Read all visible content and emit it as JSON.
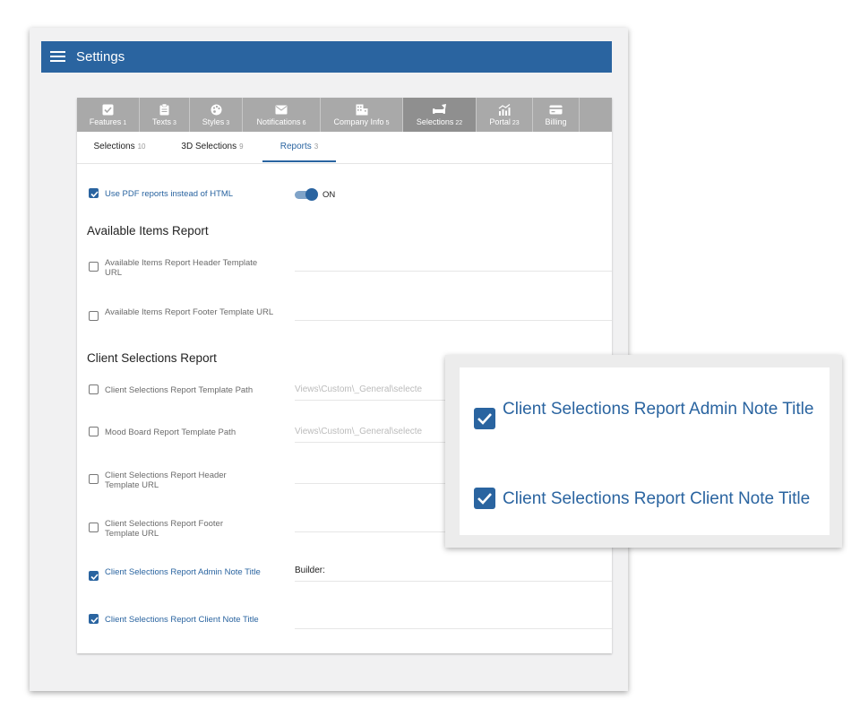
{
  "app": {
    "title": "Settings"
  },
  "tabs": [
    {
      "label": "Features",
      "count": "1",
      "icon": "checkbox-icon"
    },
    {
      "label": "Texts",
      "count": "3",
      "icon": "clipboard-icon"
    },
    {
      "label": "Styles",
      "count": "3",
      "icon": "palette-icon"
    },
    {
      "label": "Notifications",
      "count": "6",
      "icon": "mail-icon"
    },
    {
      "label": "Company Info",
      "count": "5",
      "icon": "building-icon"
    },
    {
      "label": "Selections",
      "count": "22",
      "icon": "sofa-icon"
    },
    {
      "label": "Portal",
      "count": "23",
      "icon": "chart-icon"
    },
    {
      "label": "Billing",
      "count": "",
      "icon": "credit-card-icon"
    }
  ],
  "subtabs": [
    {
      "label": "Selections",
      "count": "10"
    },
    {
      "label": "3D Selections",
      "count": "9"
    },
    {
      "label": "Reports",
      "count": "3"
    }
  ],
  "pdf": {
    "label": "Use PDF reports instead of HTML",
    "toggle_text": "ON",
    "checked": true,
    "on": true
  },
  "available_section": {
    "heading": "Available Items Report",
    "items": [
      {
        "label": "Available Items Report Header Template URL",
        "value": "",
        "checked": false
      },
      {
        "label": "Available Items Report Footer Template URL",
        "value": "",
        "checked": false
      }
    ]
  },
  "client_section": {
    "heading": "Client Selections Report",
    "items": [
      {
        "label": "Client Selections Report Template Path",
        "value": "Views\\Custom\\_General\\selecte",
        "checked": false
      },
      {
        "label": "Mood Board Report Template Path",
        "value": "Views\\Custom\\_General\\selecte",
        "checked": false
      },
      {
        "label": "Client Selections Report Header Template URL",
        "value": "",
        "checked": false
      },
      {
        "label": "Client Selections Report Footer Template URL",
        "value": "",
        "checked": false
      },
      {
        "label": "Client Selections Report Admin Note Title",
        "value": "Builder:",
        "checked": true
      },
      {
        "label": "Client Selections Report Client Note Title",
        "value": "",
        "checked": true
      }
    ]
  },
  "zoom": {
    "items": [
      {
        "label": "Client Selections Report Admin Note Title",
        "checked": true
      },
      {
        "label": "Client Selections Report Client Note Title",
        "checked": true
      }
    ]
  },
  "colors": {
    "primary": "#2a64a0",
    "tabbar": "#a9a9a9",
    "tab_active": "#8f8f8f",
    "background": "#f1f1f2"
  }
}
